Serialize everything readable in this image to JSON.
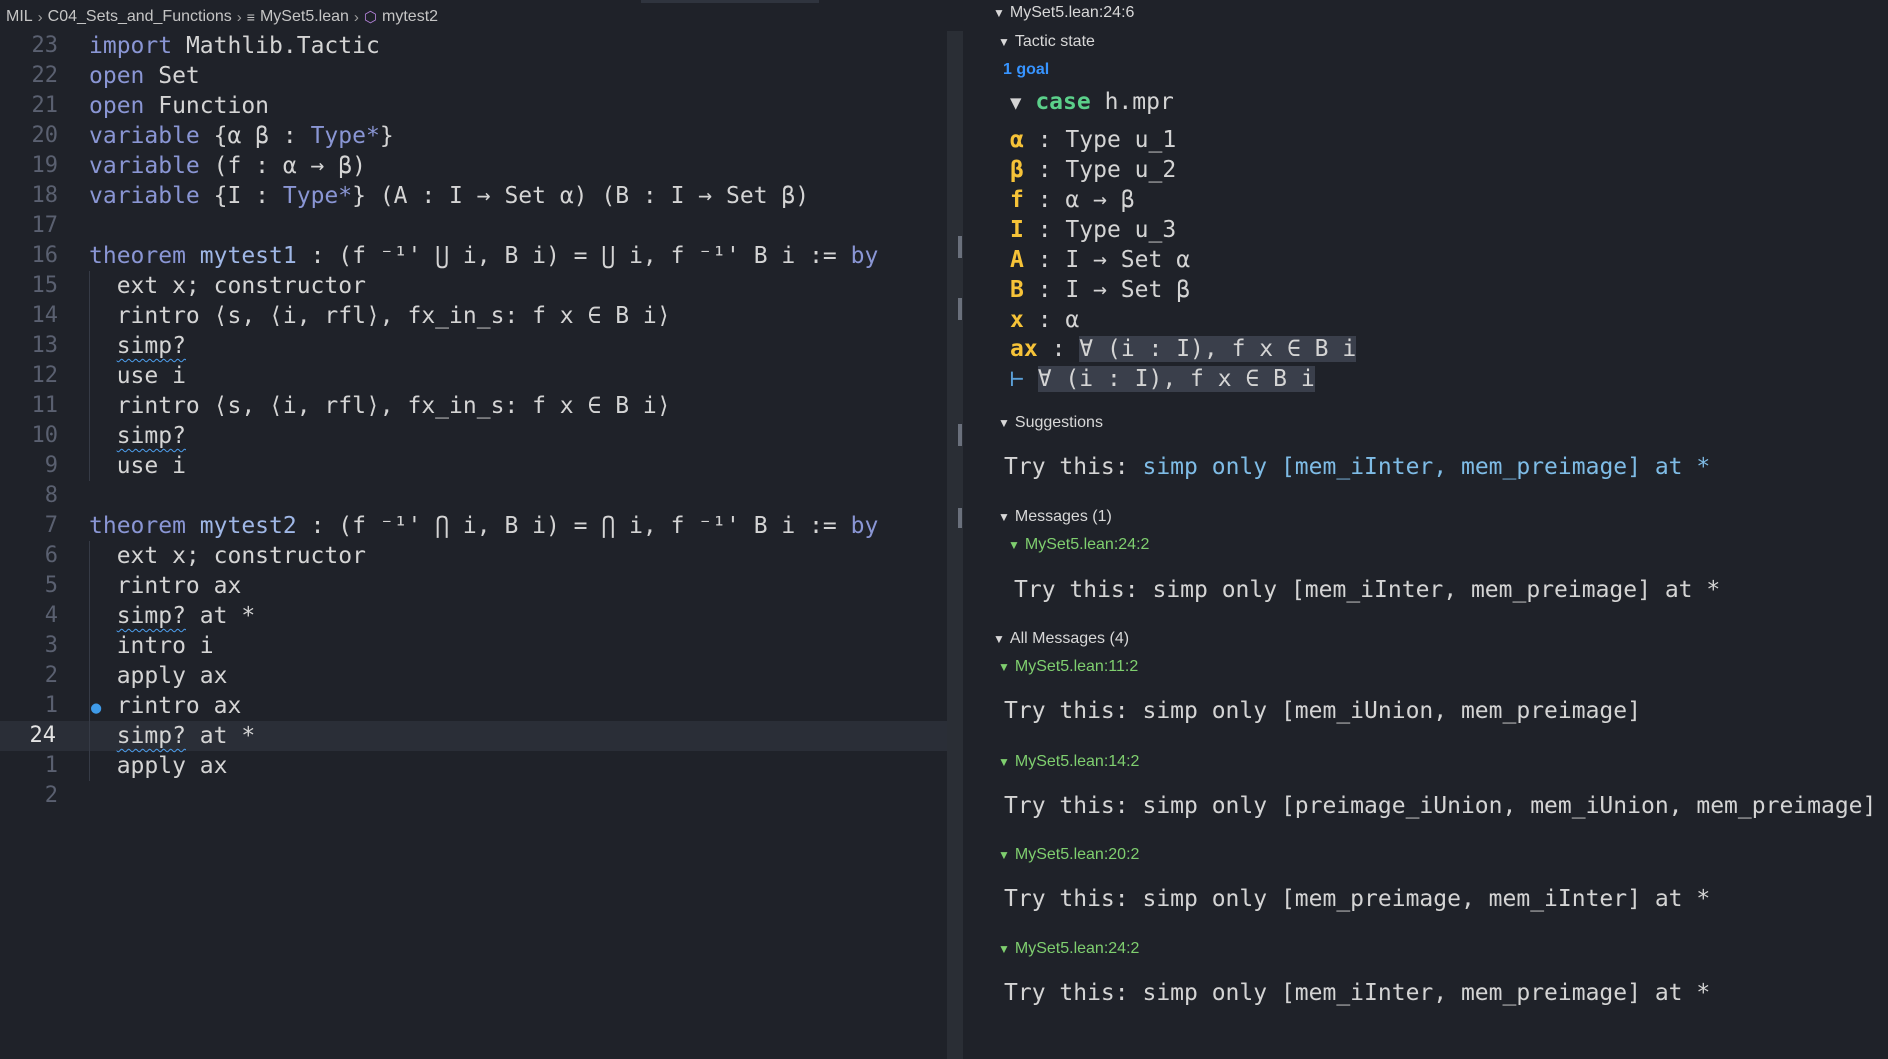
{
  "breadcrumb": {
    "root": "MIL",
    "folder": "C04_Sets_and_Functions",
    "file": "MySet5.lean",
    "symbol": "mytest2"
  },
  "editor": {
    "lines": [
      {
        "n": "23",
        "tokens": [
          {
            "t": "import",
            "c": "kw"
          },
          {
            "t": " Mathlib.Tactic"
          }
        ]
      },
      {
        "n": "22",
        "tokens": [
          {
            "t": "open",
            "c": "kw"
          },
          {
            "t": " Set"
          }
        ]
      },
      {
        "n": "21",
        "tokens": [
          {
            "t": "open",
            "c": "kw"
          },
          {
            "t": " Function"
          }
        ]
      },
      {
        "n": "20",
        "tokens": [
          {
            "t": "variable",
            "c": "kw"
          },
          {
            "t": " {α β : "
          },
          {
            "t": "Type*",
            "c": "kw"
          },
          {
            "t": "}"
          }
        ]
      },
      {
        "n": "19",
        "tokens": [
          {
            "t": "variable",
            "c": "kw"
          },
          {
            "t": " (f : α → β)"
          }
        ]
      },
      {
        "n": "18",
        "tokens": [
          {
            "t": "variable",
            "c": "kw"
          },
          {
            "t": " {I : "
          },
          {
            "t": "Type*",
            "c": "kw"
          },
          {
            "t": "} (A : I → Set α) (B : I → Set β)"
          }
        ]
      },
      {
        "n": "17",
        "tokens": []
      },
      {
        "n": "16",
        "tokens": [
          {
            "t": "theorem",
            "c": "kw"
          },
          {
            "t": " "
          },
          {
            "t": "mytest1",
            "c": "fn"
          },
          {
            "t": " : (f ⁻¹' ⋃ i, B i) = ⋃ i, f ⁻¹' B i := "
          },
          {
            "t": "by",
            "c": "kw"
          }
        ]
      },
      {
        "n": "15",
        "tokens": [
          {
            "t": "  ext x; constructor"
          }
        ]
      },
      {
        "n": "14",
        "tokens": [
          {
            "t": "  rintro ⟨s, ⟨i, rfl⟩, fx_in_s: f x ∈ B i⟩"
          }
        ]
      },
      {
        "n": "13",
        "tokens": [
          {
            "t": "  "
          },
          {
            "t": "simp?",
            "c": "squig"
          }
        ]
      },
      {
        "n": "12",
        "tokens": [
          {
            "t": "  use i"
          }
        ]
      },
      {
        "n": "11",
        "tokens": [
          {
            "t": "  rintro ⟨s, ⟨i, rfl⟩, fx_in_s: f x ∈ B i⟩"
          }
        ]
      },
      {
        "n": "10",
        "tokens": [
          {
            "t": "  "
          },
          {
            "t": "simp?",
            "c": "squig"
          }
        ]
      },
      {
        "n": "9",
        "tokens": [
          {
            "t": "  use i"
          }
        ]
      },
      {
        "n": "8",
        "tokens": []
      },
      {
        "n": "7",
        "tokens": [
          {
            "t": "theorem",
            "c": "kw"
          },
          {
            "t": " "
          },
          {
            "t": "mytest2",
            "c": "fn"
          },
          {
            "t": " : (f ⁻¹' ⋂ i, B i) = ⋂ i, f ⁻¹' B i := "
          },
          {
            "t": "by",
            "c": "kw"
          }
        ]
      },
      {
        "n": "6",
        "tokens": [
          {
            "t": "  ext x; constructor"
          }
        ]
      },
      {
        "n": "5",
        "tokens": [
          {
            "t": "  rintro ax"
          }
        ]
      },
      {
        "n": "4",
        "tokens": [
          {
            "t": "  "
          },
          {
            "t": "simp?",
            "c": "squig"
          },
          {
            "t": " at *"
          }
        ]
      },
      {
        "n": "3",
        "tokens": [
          {
            "t": "  intro i"
          }
        ]
      },
      {
        "n": "2",
        "tokens": [
          {
            "t": "  apply ax"
          }
        ]
      },
      {
        "n": "1",
        "tokens": [
          {
            "t": "  rintro ax"
          }
        ],
        "icon": true
      },
      {
        "n": "24",
        "tokens": [
          {
            "t": "  "
          },
          {
            "t": "simp?",
            "c": "squig"
          },
          {
            "t": " at *"
          }
        ],
        "current": true
      },
      {
        "n": "1",
        "tokens": [
          {
            "t": "  apply ax"
          }
        ]
      },
      {
        "n": "2",
        "tokens": []
      }
    ]
  },
  "infoview": {
    "position": "MySet5.lean:24:6",
    "tactic_state_label": "Tactic state",
    "goal_count": "1 goal",
    "case_keyword": "case",
    "case_name": "h.mpr",
    "hypotheses": [
      {
        "name": "α",
        "type": ": Type u_1"
      },
      {
        "name": "β",
        "type": ": Type u_2"
      },
      {
        "name": "f",
        "type": ": α → β"
      },
      {
        "name": "I",
        "type": ": Type u_3"
      },
      {
        "name": "A",
        "type": ": I → Set α"
      },
      {
        "name": "B",
        "type": ": I → Set β"
      },
      {
        "name": "x",
        "type": ": α"
      }
    ],
    "ax_name": "ax",
    "ax_sep": ":",
    "ax_type": "∀ (i : I), f x ∈ B i",
    "goal_turnstile": "⊢",
    "goal_type": "∀ (i : I), f x ∈ B i",
    "suggestions_label": "Suggestions",
    "suggestion_prefix": "Try this: ",
    "suggestion_text": "simp only [mem_iInter, mem_preimage] at *",
    "messages_label": "Messages (1)",
    "messages": [
      {
        "loc": "MySet5.lean:24:2",
        "text": "Try this: simp only [mem_iInter, mem_preimage] at *"
      }
    ],
    "all_messages_label": "All Messages (4)",
    "all_messages": [
      {
        "loc": "MySet5.lean:11:2",
        "text": "Try this: simp only [mem_iUnion, mem_preimage]"
      },
      {
        "loc": "MySet5.lean:14:2",
        "text": "Try this: simp only [preimage_iUnion, mem_iUnion, mem_preimage]"
      },
      {
        "loc": "MySet5.lean:20:2",
        "text": "Try this: simp only [mem_preimage, mem_iInter] at *"
      },
      {
        "loc": "MySet5.lean:24:2",
        "text": "Try this: simp only [mem_iInter, mem_preimage] at *"
      }
    ]
  },
  "colors": {
    "background": "#1f2229",
    "keyword": "#8a96d4",
    "hypothesis_name": "#f6c338",
    "case_keyword": "#5bd08a",
    "location_link": "#7fcf6f",
    "goal_count": "#3794ff"
  }
}
